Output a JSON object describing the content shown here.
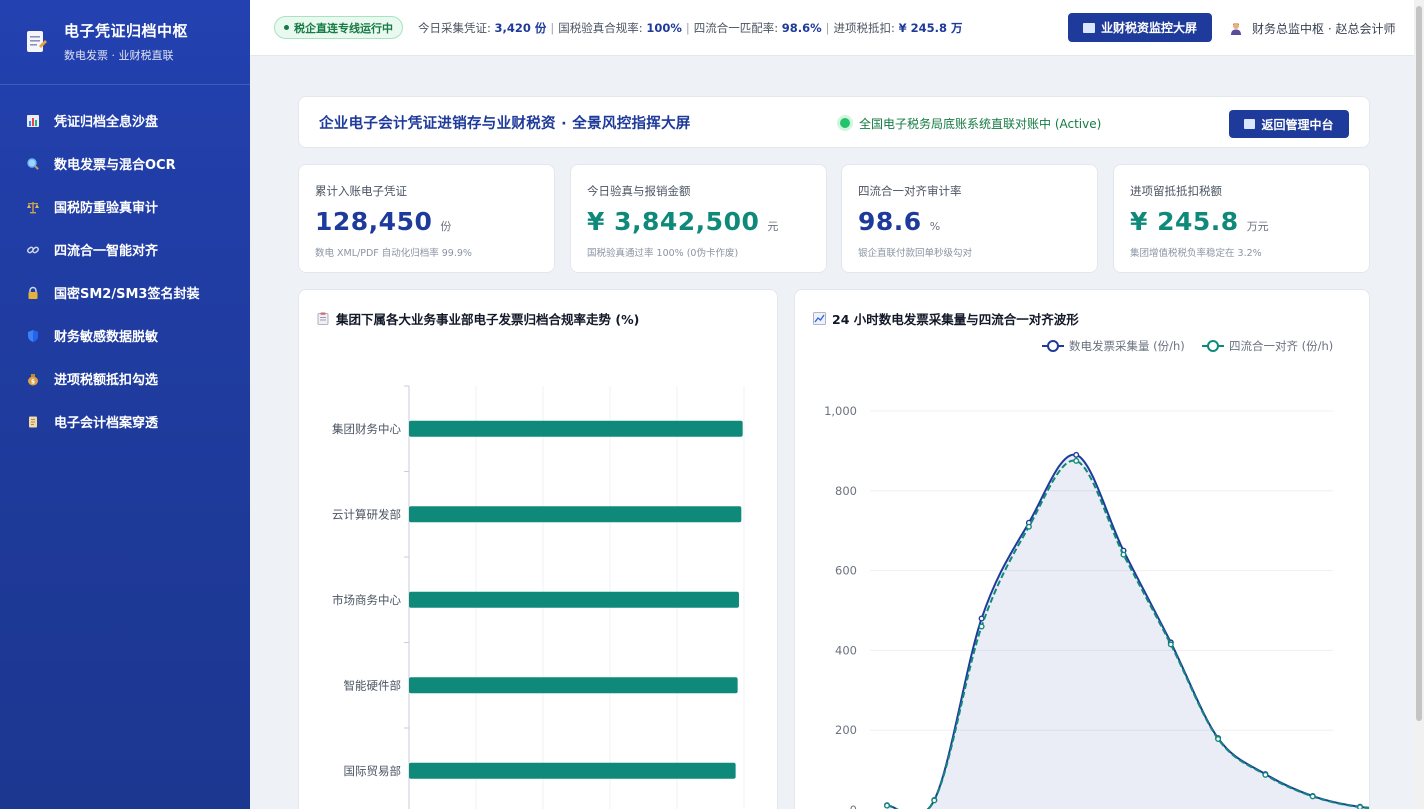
{
  "sidebar": {
    "brand_title": "电子凭证归档中枢",
    "brand_subtitle": "数电发票 · 业财税直联",
    "items": [
      {
        "label": "凭证归档全息沙盘",
        "icon": "bar-chart-icon"
      },
      {
        "label": "数电发票与混合OCR",
        "icon": "magnifier-icon"
      },
      {
        "label": "国税防重验真审计",
        "icon": "scales-icon"
      },
      {
        "label": "四流合一智能对齐",
        "icon": "link-icon"
      },
      {
        "label": "国密SM2/SM3签名封装",
        "icon": "lock-icon"
      },
      {
        "label": "财务敏感数据脱敏",
        "icon": "shield-icon"
      },
      {
        "label": "进项税额抵扣勾选",
        "icon": "money-bag-icon"
      },
      {
        "label": "电子会计档案穿透",
        "icon": "scroll-icon"
      }
    ]
  },
  "topbar": {
    "status": "税企直连专线运行中",
    "ticker": [
      {
        "label": "今日采集凭证: ",
        "value": "3,420 份"
      },
      {
        "label": "国税验真合规率: ",
        "value": "100%"
      },
      {
        "label": "四流合一匹配率: ",
        "value": "98.6%"
      },
      {
        "label": "进项税抵扣: ",
        "value": "¥ 245.8 万"
      }
    ],
    "monitor_button": "业财税资监控大屏",
    "user": "财务总监中枢 · 赵总会计师"
  },
  "header": {
    "title": "企业电子会计凭证进销存与业财税资 · 全景风控指挥大屏",
    "sync_status": "全国电子税务局底账系统直联对账中 (Active)",
    "back_button": "返回管理中台"
  },
  "kpis": [
    {
      "label": "累计入账电子凭证",
      "value": "128,450",
      "unit": "份",
      "sub": "数电 XML/PDF 自动化归档率 99.9%",
      "color": "#1e3a9a"
    },
    {
      "label": "今日验真与报销金额",
      "value": "¥ 3,842,500",
      "unit": "元",
      "sub": "国税验真通过率 100% (0伪卡作废)",
      "color": "#0f8a7a"
    },
    {
      "label": "四流合一对齐审计率",
      "value": "98.6",
      "unit": "%",
      "sub": "银企直联付款回单秒级勾对",
      "color": "#1e3a9a"
    },
    {
      "label": "进项留抵抵扣税额",
      "value": "¥ 245.8",
      "unit": "万元",
      "sub": "集团增值税税负率稳定在 3.2%",
      "color": "#0f8a7a"
    }
  ],
  "charts": {
    "bar_title": "集团下属各大业务事业部电子发票归档合规率走势 (%)",
    "line_title": "24 小时数电发票采集量与四流合一对齐波形"
  },
  "chart_data": [
    {
      "type": "bar",
      "orientation": "horizontal",
      "title": "集团下属各大业务事业部电子发票归档合规率走势 (%)",
      "categories": [
        "集团财务中心",
        "云计算研发部",
        "市场商务中心",
        "智能硬件部",
        "国际贸易部"
      ],
      "values": [
        99.6,
        99.2,
        98.5,
        98.1,
        97.5
      ],
      "xlim": [
        0,
        100
      ],
      "color": "#0f8a7a"
    },
    {
      "type": "line",
      "title": "24 小时数电发票采集量与四流合一对齐波形",
      "x": [
        0,
        2,
        4,
        6,
        8,
        10,
        12,
        14,
        16,
        18,
        20,
        22
      ],
      "series": [
        {
          "name": "数电发票采集量 (份/h)",
          "values": [
            12,
            25,
            480,
            720,
            890,
            650,
            420,
            180,
            90,
            35,
            8,
            2
          ],
          "color": "#1e3a9a",
          "dashed": false
        },
        {
          "name": "四流合一对齐 (份/h)",
          "values": [
            11,
            24,
            460,
            710,
            875,
            640,
            415,
            178,
            88,
            34,
            7,
            2
          ],
          "color": "#0f8a7a",
          "dashed": true
        }
      ],
      "ylim": [
        0,
        1000
      ],
      "yticks": [
        "0",
        "200",
        "400",
        "600",
        "800",
        "1,000"
      ],
      "legend": "top-right",
      "grid": true
    }
  ]
}
